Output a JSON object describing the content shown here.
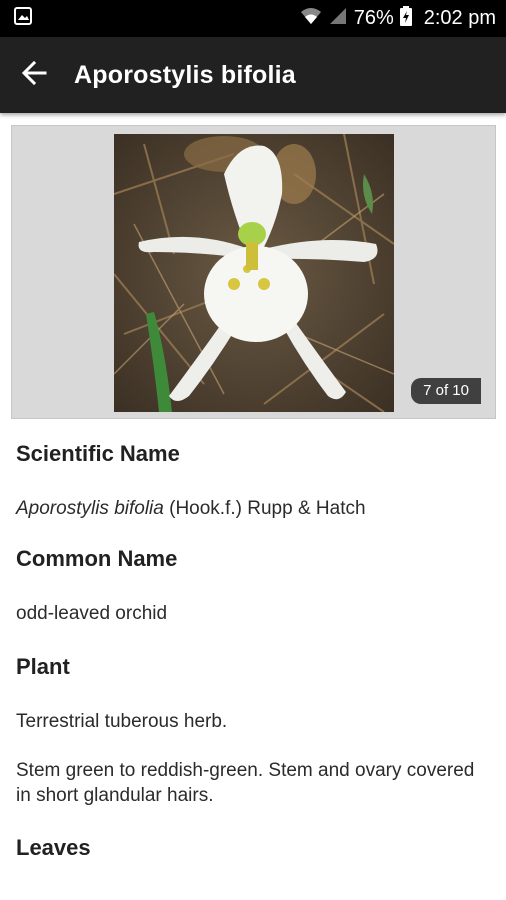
{
  "status_bar": {
    "battery": "76%",
    "time": "2:02 pm"
  },
  "app_bar": {
    "title": "Aporostylis bifolia"
  },
  "gallery": {
    "counter": "7 of 10"
  },
  "sections": {
    "scientific_name": {
      "heading": "Scientific Name",
      "name_italic": "Aporostylis bifolia",
      "authority": " (Hook.f.) Rupp & Hatch"
    },
    "common_name": {
      "heading": "Common Name",
      "value": "odd-leaved orchid"
    },
    "plant": {
      "heading": "Plant",
      "para1": "Terrestrial tuberous herb.",
      "para2": "Stem green to reddish-green. Stem and ovary covered in short glandular hairs."
    },
    "leaves": {
      "heading": "Leaves"
    }
  }
}
